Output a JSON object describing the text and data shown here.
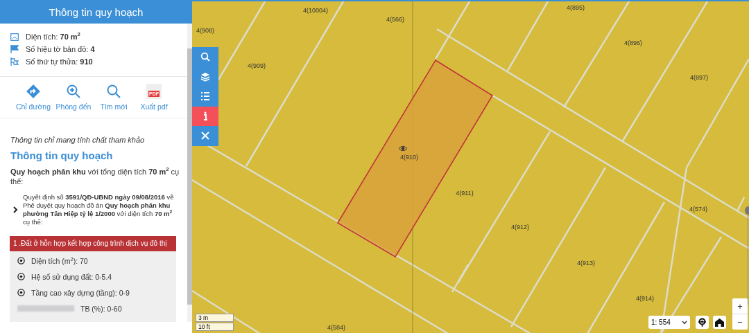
{
  "panel": {
    "title": "Thông tin quy hoạch",
    "parcel_info": [
      {
        "kind": "area",
        "label": "Diện tích:",
        "value": "70 m$^{2}$"
      },
      {
        "kind": "sheet",
        "label": "Số hiệu tờ bản đồ:",
        "value": "4"
      },
      {
        "kind": "parcel",
        "label": "Số thứ tự thửa:",
        "value": "910"
      }
    ],
    "actions": [
      {
        "kind": "directions",
        "label": "Chỉ đường"
      },
      {
        "kind": "zoom",
        "label": "Phóng đến"
      },
      {
        "kind": "search",
        "label": "Tìm mới"
      },
      {
        "kind": "pdf",
        "label": "Xuất pdf",
        "badge": "PDF"
      }
    ],
    "note": "Thông tin chỉ mang tính chất tham khảo",
    "section_title": "Thông tin quy hoạch",
    "summary": "**Quy hoạch phân khu** với tổng diện tích **70 m$^{2}$** cụ thể:",
    "decision": {
      "expanded": false,
      "text": "Quyết định số **3591/QĐ-UBND ngày 09/08/2016** về Phê duyệt quy hoạch đồ án **Quy hoạch phân khu phường Tân Hiệp tỷ lệ 1/2000** với diện tích **70 m$^{2}$** cụ thể:"
    },
    "zone": {
      "title": "1 .Đất ở hỗn hợp kết hợp công trình dịch vụ đô thị",
      "items": [
        {
          "kind": "bullet",
          "text": "Diện tích (m$^{2}$): 70"
        },
        {
          "kind": "bullet",
          "text": "Hệ số sử dụng đất: 0-5.4"
        },
        {
          "kind": "bullet",
          "text": "Tầng cao xây dựng (tầng): 0-9"
        },
        {
          "kind": "obscured",
          "text": "TB (%): 0-60"
        }
      ]
    }
  },
  "map": {
    "toolbar": [
      {
        "kind": "search",
        "selected": false
      },
      {
        "kind": "layers",
        "selected": false
      },
      {
        "kind": "list",
        "selected": false
      },
      {
        "kind": "info",
        "selected": true
      },
      {
        "kind": "close",
        "selected": false
      }
    ],
    "parcels": [
      {
        "label": "4(10004)"
      },
      {
        "label": "4(566)"
      },
      {
        "label": "4(908)"
      },
      {
        "label": "4(909)"
      },
      {
        "label": "4(910)"
      },
      {
        "label": "4(895)"
      },
      {
        "label": "4(896)"
      },
      {
        "label": "4(897)"
      },
      {
        "label": "4(911)"
      },
      {
        "label": "4(912)"
      },
      {
        "label": "4(574)"
      },
      {
        "label": "4(913)"
      },
      {
        "label": "4(914)"
      },
      {
        "label": "4(584)"
      }
    ],
    "scale_bar": [
      "3 m",
      "10 ft"
    ],
    "scale": "1: 554",
    "zoom": {
      "in": "+",
      "out": "−"
    }
  }
}
